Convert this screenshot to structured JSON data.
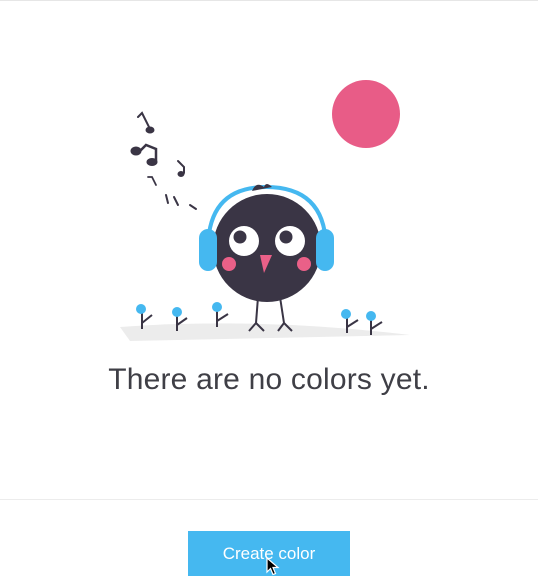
{
  "empty_state": {
    "message": "There are no colors yet.",
    "illustration_icon": "bird-with-headphones-icon",
    "colors": {
      "sun": "#e85c87",
      "bird_body": "#3a3545",
      "headphones": "#45b8f0",
      "cheeks": "#ea6088",
      "flowers": "#45b8f0"
    }
  },
  "footer": {
    "create_label": "Create color",
    "button_color": "#45b8f0"
  },
  "pointer": {
    "icon": "cursor-arrow-icon"
  }
}
